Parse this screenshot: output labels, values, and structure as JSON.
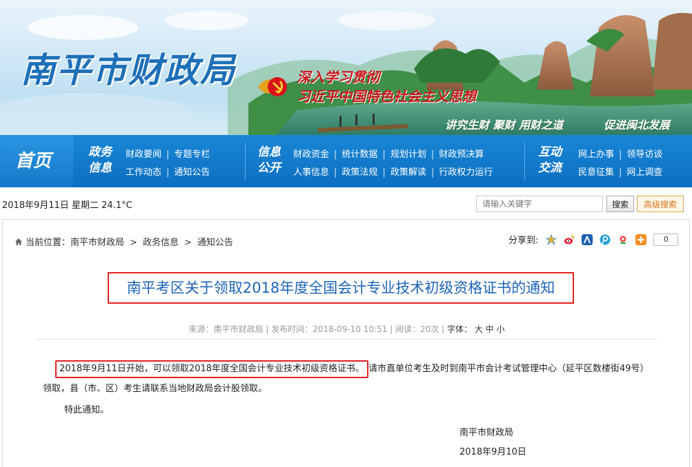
{
  "banner": {
    "site_title": "南平市财政局",
    "slogan_line1": "深入学习贯彻",
    "slogan_line2": "习近平中国特色社会主义思想",
    "motto_left": "讲究生财 聚财 用财之道",
    "motto_right": "促进闽北发展"
  },
  "nav": {
    "home_label": "首页",
    "groups": [
      {
        "heading_top": "政务",
        "heading_bottom": "信息",
        "rows": [
          [
            "财政要闻",
            "专题专栏"
          ],
          [
            "工作动态",
            "通知公告"
          ]
        ]
      },
      {
        "heading_top": "信息",
        "heading_bottom": "公开",
        "rows": [
          [
            "财政资金",
            "统计数据",
            "规划计划",
            "财政预决算"
          ],
          [
            "人事信息",
            "政策法规",
            "政策解读",
            "行政权力运行"
          ]
        ]
      },
      {
        "heading_top": "互动",
        "heading_bottom": "交流",
        "rows": [
          [
            "网上办事",
            "领导访谈"
          ],
          [
            "民意征集",
            "网上调查"
          ]
        ]
      }
    ]
  },
  "toolbar": {
    "date_weather": "2018年9月11日 星期二 24.1°C",
    "search_placeholder": "请输入关键字",
    "search_button": "搜索",
    "advanced_search": "高级搜索"
  },
  "breadcrumb": {
    "prefix": "当前位置：",
    "items": [
      "南平市财政局",
      "政务信息",
      "通知公告"
    ],
    "separator": ">"
  },
  "share": {
    "label": "分享到:",
    "icons": [
      "qzone-icon",
      "weibo-icon",
      "renren-icon",
      "tencent-weibo-icon",
      "douban-icon",
      "more-share-icon"
    ],
    "count": "0"
  },
  "article": {
    "title": "南平考区关于领取2018年度全国会计专业技术初级资格证书的通知",
    "meta": {
      "source_label": "来源：",
      "source": "南平市财政局",
      "published_label": "发布时间：",
      "published": "2018-09-10 10:51",
      "views_label": "阅读：",
      "views": "20次",
      "font_label": "字体：",
      "font_sizes": [
        "大",
        "中",
        "小"
      ]
    },
    "highlight": "2018年9月11日开始，可以领取2018年度全国会计专业技术初级资格证书。",
    "paragraph1_rest": "请市直单位考生及时到南平市会计考试管理中心（延平区数楼街49号）领取，县（市、区）考生请联系当地财政局会计股领取。",
    "paragraph2": "特此通知。",
    "signature": "南平市财政局",
    "sign_date": "2018年9月10日"
  },
  "colors": {
    "nav_blue": "#0c6fc0",
    "title_blue": "#1c64b8",
    "highlight_red": "#e02222",
    "slogan_red": "#c8161d"
  }
}
